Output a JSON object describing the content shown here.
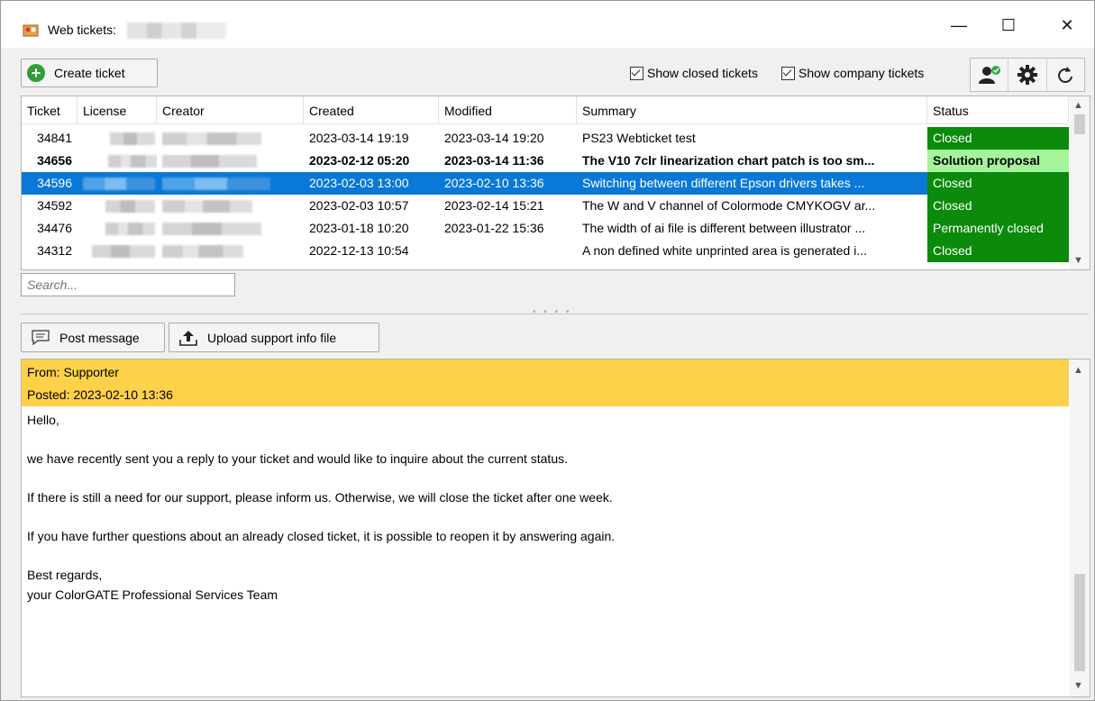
{
  "window": {
    "title": "Web tickets:",
    "controls": {
      "minimize": "—",
      "maximize": "☐",
      "close": "✕"
    }
  },
  "toolbar": {
    "create_label": "Create ticket",
    "show_closed_label": "Show closed tickets",
    "show_company_label": "Show company tickets",
    "show_closed_checked": true,
    "show_company_checked": true,
    "icons": [
      "user-check-icon",
      "gear-icon",
      "refresh-icon"
    ]
  },
  "grid": {
    "columns": [
      "Ticket",
      "License",
      "Creator",
      "Created",
      "Modified",
      "Summary",
      "Status"
    ],
    "rows": [
      {
        "ticket": "34841",
        "created": "2023-03-14 19:19",
        "modified": "2023-03-14 19:20",
        "summary": "PS23 Webticket test",
        "status": "Closed",
        "style": "normal"
      },
      {
        "ticket": "34656",
        "created": "2023-02-12 05:20",
        "modified": "2023-03-14 11:36",
        "summary": "The V10 7clr linearization chart patch is too sm...",
        "status": "Solution proposal",
        "style": "bold"
      },
      {
        "ticket": "34596",
        "created": "2023-02-03 13:00",
        "modified": "2023-02-10 13:36",
        "summary": "Switching between different Epson drivers takes ...",
        "status": "Closed",
        "style": "selected"
      },
      {
        "ticket": "34592",
        "created": "2023-02-03 10:57",
        "modified": "2023-02-14 15:21",
        "summary": "The W and V channel of Colormode CMYKOGV ar...",
        "status": "Closed",
        "style": "normal"
      },
      {
        "ticket": "34476",
        "created": "2023-01-18 10:20",
        "modified": "2023-01-22 15:36",
        "summary": "The width of ai file is different between illustrator ...",
        "status": "Permanently closed",
        "style": "normal"
      },
      {
        "ticket": "34312",
        "created": "2022-12-13 10:54",
        "modified": "",
        "summary": "A non defined white unprinted area is generated i...",
        "status": "Closed",
        "style": "normal"
      }
    ]
  },
  "search": {
    "placeholder": "Search..."
  },
  "message_toolbar": {
    "post_label": "Post message",
    "upload_label": "Upload support info file"
  },
  "message": {
    "from": "From: Supporter",
    "posted": "Posted: 2023-02-10 13:36",
    "paragraphs": [
      "Hello,",
      "we have recently sent you a reply to your ticket and would like to inquire about the current status.",
      "If there is still a need for our support, please inform us. Otherwise, we will close the ticket after one week.",
      "If you have further questions about an already closed ticket, it is possible to reopen it by answering again.",
      "Best regards,",
      "your ColorGATE Professional Services Team"
    ]
  },
  "colors": {
    "selected_row": "#0a78d7",
    "status_closed": "#0b8a0b",
    "status_proposal": "#a5f39b",
    "message_header": "#fdd149"
  }
}
